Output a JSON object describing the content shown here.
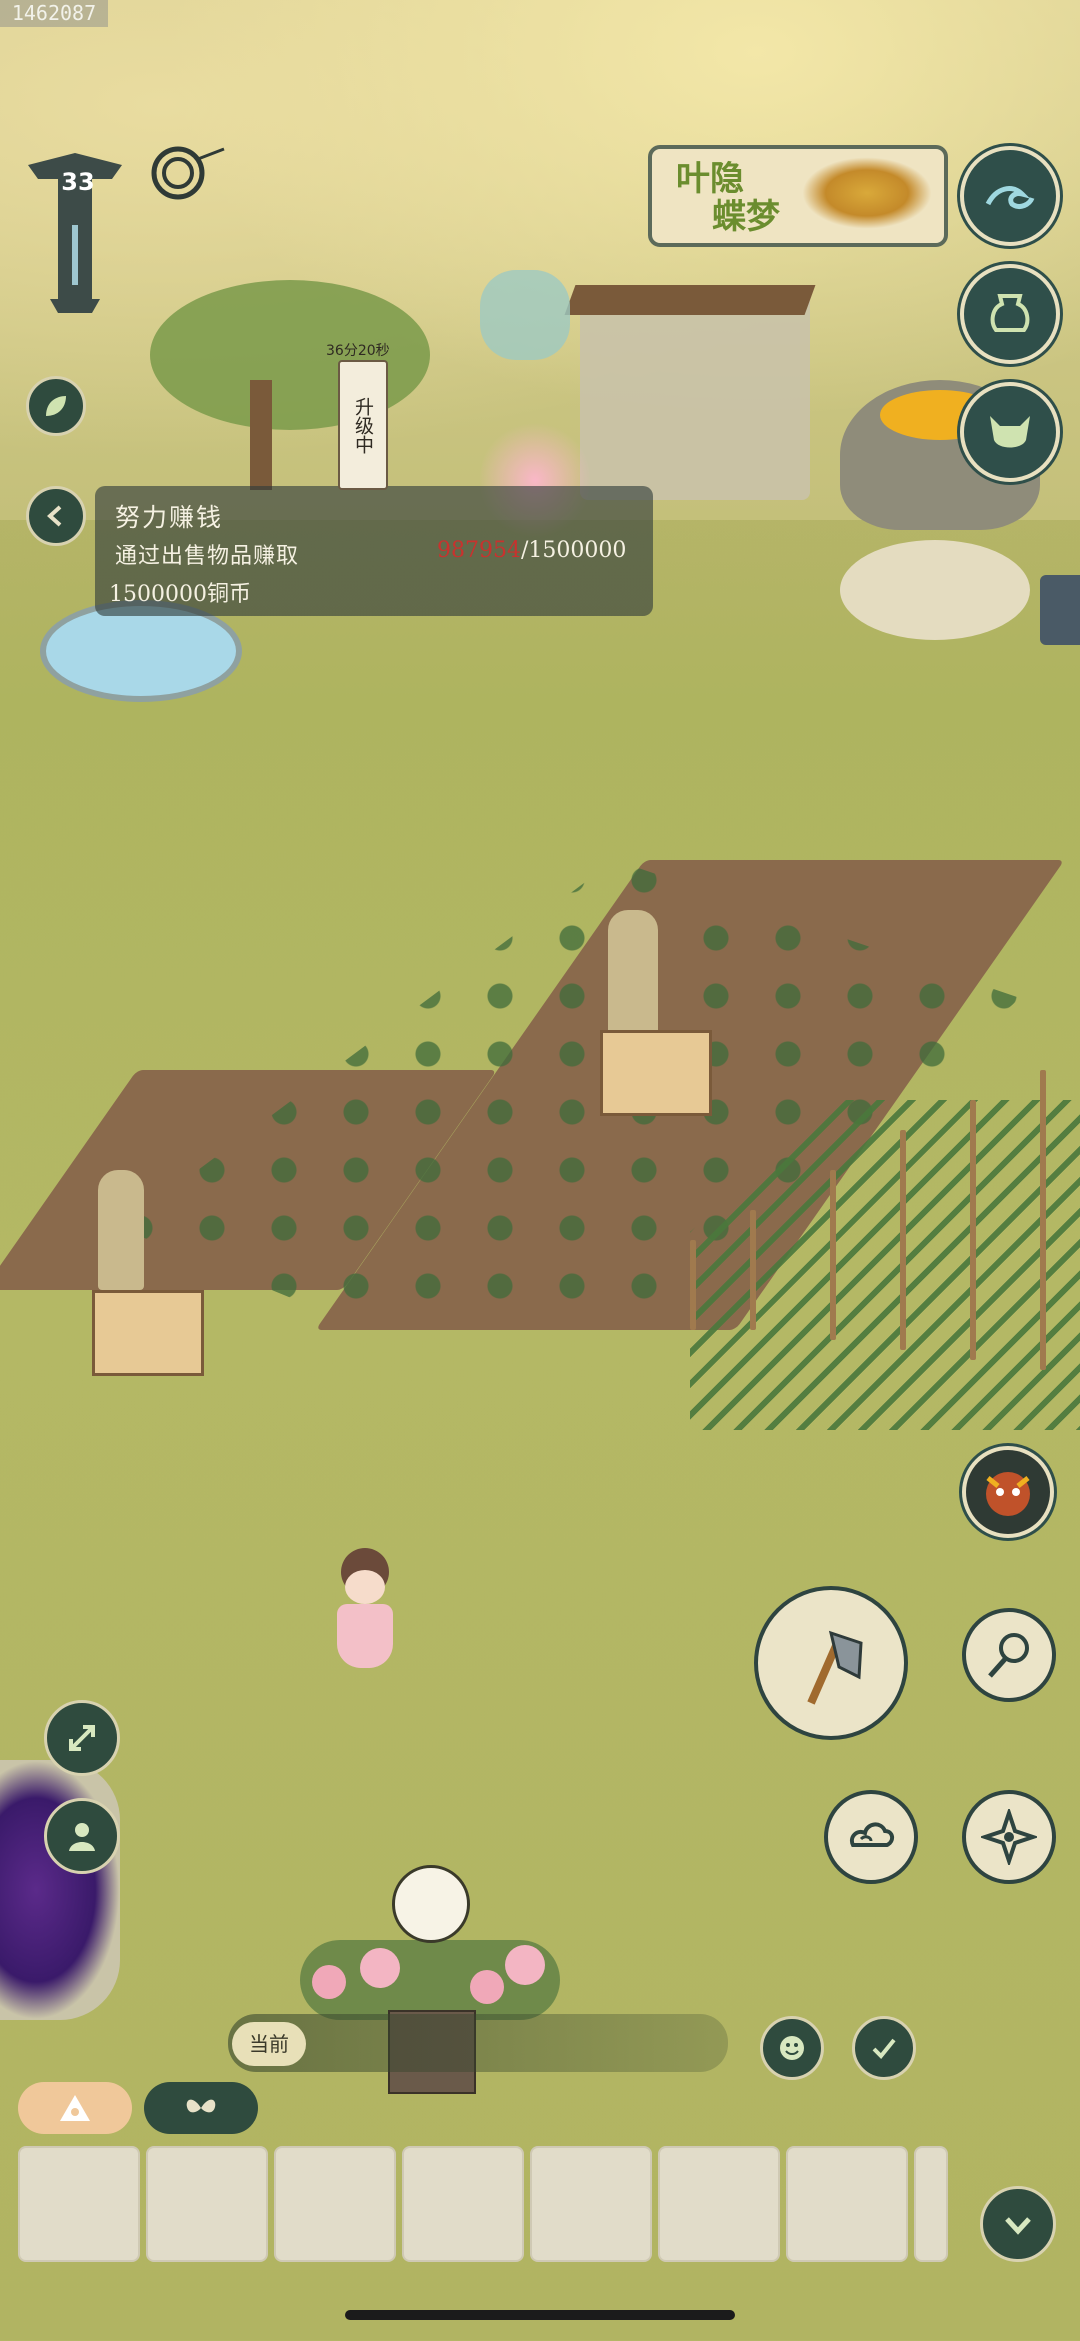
{
  "image_id": "1462087",
  "player": {
    "level": "33"
  },
  "upgrade": {
    "timer": "36分20秒",
    "status": "升级中"
  },
  "quest": {
    "title": "努力赚钱",
    "description": "通过出售物品赚取",
    "progress_current": "987954",
    "progress_total": "/1500000",
    "reward": "1500000铜币"
  },
  "logo": {
    "line1": "叶隐",
    "line2": "蝶梦"
  },
  "hud": {
    "current_label": "当前",
    "right_buttons": [
      "wave-icon",
      "jar-icon",
      "demon-mask-icon"
    ],
    "tools": [
      "hoe-icon",
      "net-icon",
      "cloud-icon",
      "shuriken-icon"
    ]
  },
  "hotbar": {
    "slots": [
      "",
      "",
      "",
      "",
      "",
      "",
      "",
      ""
    ]
  },
  "colors": {
    "accent": "#2f4f4a",
    "progress_red": "#c8322e",
    "panel": "#303c3a"
  }
}
